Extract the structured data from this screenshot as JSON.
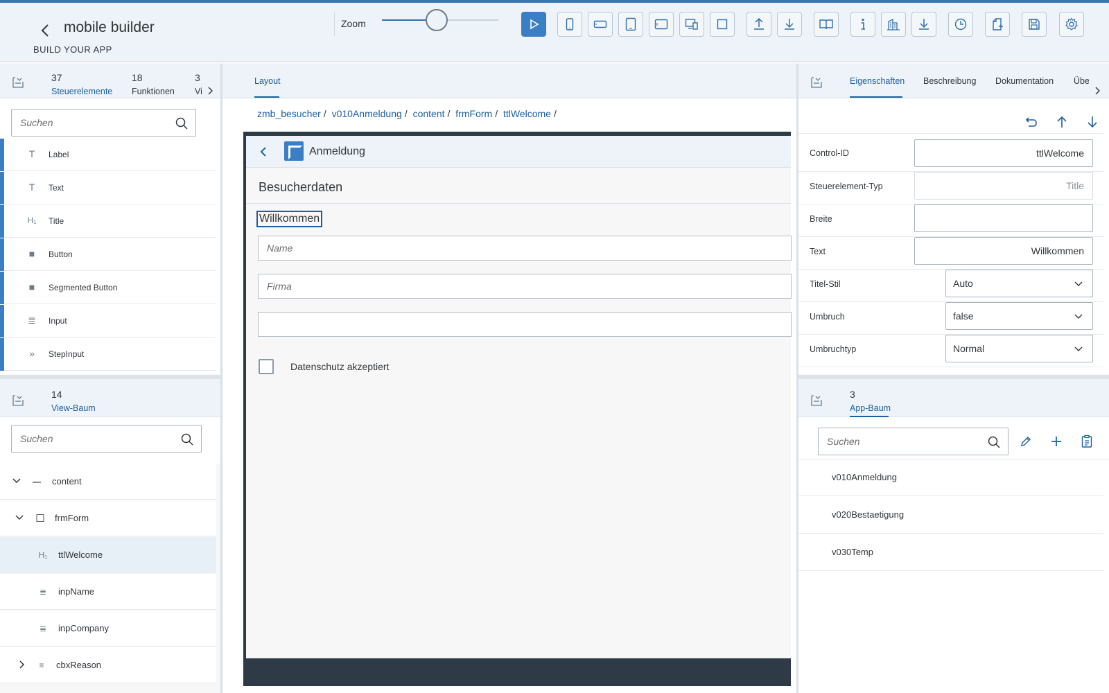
{
  "header": {
    "title": "mobile builder",
    "subtitle": "BUILD YOUR APP",
    "zoom_label": "Zoom",
    "zoom_level": 0.47,
    "toolbar_icons": [
      "play-icon",
      "phone-portrait-icon",
      "phone-landscape-icon",
      "tablet-portrait-icon",
      "tablet-landscape-icon",
      "desktop-icon",
      "fullscreen-icon",
      "upload-icon",
      "download-icon",
      "book-icon",
      "info-icon",
      "buildings-icon",
      "download-alt-icon",
      "history-icon",
      "new-file-icon",
      "save-icon",
      "settings-icon"
    ]
  },
  "left_top": {
    "tabs": [
      {
        "count": "37",
        "label": "Steuerelemente"
      },
      {
        "count": "18",
        "label": "Funktionen"
      },
      {
        "count": "3",
        "label": "Vi"
      }
    ],
    "search_placeholder": "Suchen",
    "controls": [
      {
        "icon": "text-t-icon",
        "glyph": "T",
        "label": "Label"
      },
      {
        "icon": "text-t-icon",
        "glyph": "T",
        "label": "Text"
      },
      {
        "icon": "heading-h1-icon",
        "glyph": "H₁",
        "label": "Title"
      },
      {
        "icon": "square-button-icon",
        "glyph": "■",
        "label": "Button"
      },
      {
        "icon": "square-button-icon",
        "glyph": "■",
        "label": "Segmented Button"
      },
      {
        "icon": "input-lines-icon",
        "glyph": "≣",
        "label": "Input"
      },
      {
        "icon": "chevrons-right-icon",
        "glyph": "»",
        "label": "StepInput"
      }
    ]
  },
  "left_bottom": {
    "tab_count": "14",
    "tab_label": "View-Baum",
    "search_placeholder": "Suchen",
    "tree": [
      {
        "label": "content",
        "icon": "minus-icon",
        "glyph": "—",
        "expander": "chevron-down-icon",
        "indent": 0,
        "selected": false
      },
      {
        "label": "frmForm",
        "icon": "square-outline-icon",
        "glyph": "☐",
        "expander": "chevron-down-icon",
        "indent": 1,
        "selected": false
      },
      {
        "label": "ttlWelcome",
        "icon": "heading-h1-icon",
        "glyph": "H₁",
        "expander": "",
        "indent": 2,
        "selected": true
      },
      {
        "label": "inpName",
        "icon": "input-lines-icon",
        "glyph": "≣",
        "expander": "",
        "indent": 2,
        "selected": false
      },
      {
        "label": "inpCompany",
        "icon": "input-lines-icon",
        "glyph": "≣",
        "expander": "",
        "indent": 2,
        "selected": false
      },
      {
        "label": "cbxReason",
        "icon": "list-icon",
        "glyph": "≡",
        "expander": "chevron-right-icon",
        "indent": 1,
        "selected": false
      }
    ]
  },
  "center": {
    "tab_label": "Layout",
    "breadcrumb": [
      "zmb_besucher",
      "v010Anmeldung",
      "content",
      "frmForm",
      "ttlWelcome"
    ],
    "preview": {
      "header_title": "Anmeldung",
      "section_title": "Besucherdaten",
      "welcome_title": "Willkommen",
      "input_name_placeholder": "Name",
      "input_company_placeholder": "Firma",
      "input_third_placeholder": "",
      "checkbox_label": "Datenschutz akzeptiert"
    }
  },
  "right_top": {
    "tabs": [
      "Eigenschaften",
      "Beschreibung",
      "Dokumentation",
      "Übe"
    ],
    "properties": {
      "control_id_label": "Control-ID",
      "control_id_value": "ttlWelcome",
      "type_label": "Steuerelement-Typ",
      "type_placeholder": "Title",
      "width_label": "Breite",
      "width_value": "",
      "text_label": "Text",
      "text_value": "Willkommen",
      "title_style_label": "Titel-Stil",
      "title_style_value": "Auto",
      "wrap_label": "Umbruch",
      "wrap_value": "false",
      "wrap_type_label": "Umbruchtyp",
      "wrap_type_value": "Normal"
    }
  },
  "right_bottom": {
    "tab_count": "3",
    "tab_label": "App-Baum",
    "search_placeholder": "Suchen",
    "items": [
      "v010Anmeldung",
      "v020Bestaetigung",
      "v030Temp"
    ]
  }
}
